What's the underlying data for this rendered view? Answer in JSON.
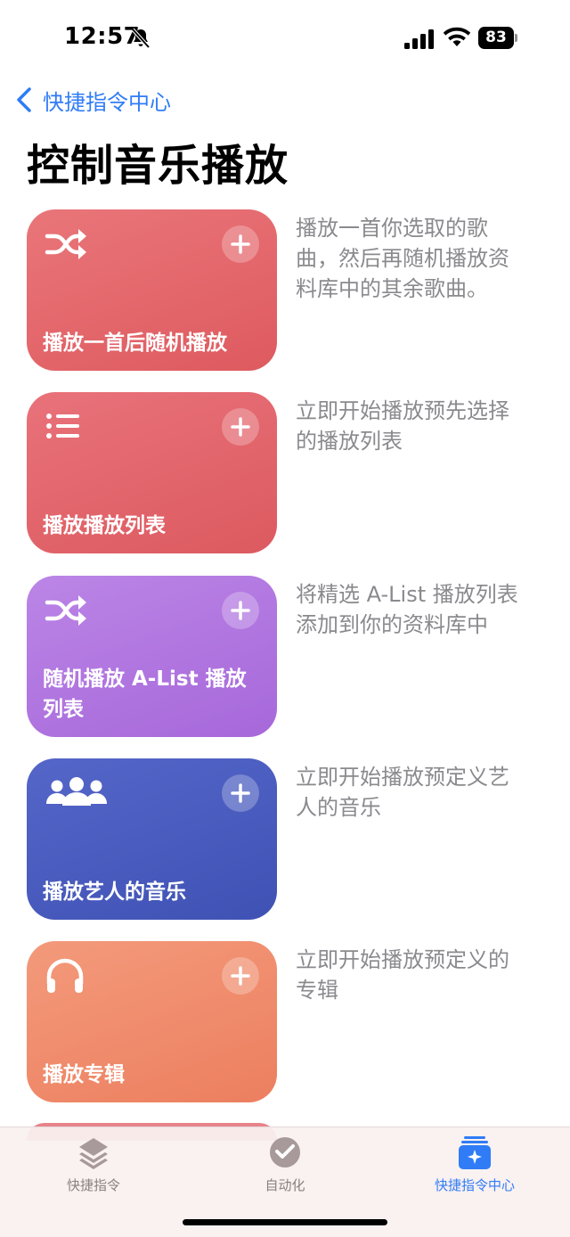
{
  "status_bar": {
    "time": "12:57",
    "battery": "83"
  },
  "nav": {
    "back_label": "快捷指令中心"
  },
  "page": {
    "title": "控制音乐播放"
  },
  "shortcuts": [
    {
      "label": "播放一首后随机播放",
      "icon": "shuffle-icon",
      "color": "#e26a6f",
      "description": "播放一首你选取的歌曲，然后再随机播放资料库中的其余歌曲。"
    },
    {
      "label": "播放播放列表",
      "icon": "list-icon",
      "color": "#e26a6f",
      "description": "立即开始播放预先选择的播放列表"
    },
    {
      "label": "随机播放 A-List 播放列表",
      "icon": "shuffle-icon",
      "color": "#b077e0",
      "description": "将精选 A-List 播放列表添加到你的资料库中"
    },
    {
      "label": "播放艺人的音乐",
      "icon": "people-icon",
      "color": "#4a5cbf",
      "description": "立即开始播放预定义艺人的音乐"
    },
    {
      "label": "播放专辑",
      "icon": "headphones-icon",
      "color": "#ef8c6c",
      "description": "立即开始播放预定义的专辑"
    }
  ],
  "tab_bar": {
    "tabs": [
      {
        "label": "快捷指令",
        "icon": "layers-icon",
        "active": false
      },
      {
        "label": "自动化",
        "icon": "clock-check-icon",
        "active": false
      },
      {
        "label": "快捷指令中心",
        "icon": "gallery-sparkle-icon",
        "active": true
      }
    ],
    "active_color": "#2f7cf6"
  }
}
